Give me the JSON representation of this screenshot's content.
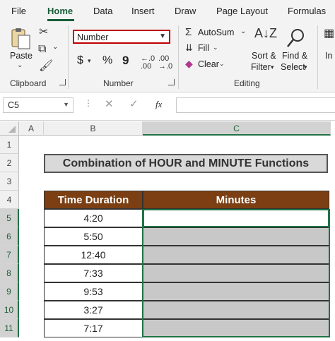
{
  "menu": {
    "tabs": [
      "File",
      "Home",
      "Data",
      "Insert",
      "Draw",
      "Page Layout",
      "Formulas"
    ],
    "active": "Home"
  },
  "ribbon": {
    "clipboard": {
      "paste_label": "Paste",
      "group_label": "Clipboard"
    },
    "number": {
      "format_value": "Number",
      "currency_symbol": "$",
      "percent_symbol": "%",
      "comma_symbol": "9",
      "group_label": "Number"
    },
    "editing": {
      "autosum_label": "AutoSum",
      "fill_label": "Fill",
      "clear_label": "Clear",
      "sort_label_1": "Sort &",
      "sort_label_2": "Filter",
      "find_label_1": "Find &",
      "find_label_2": "Select",
      "group_label": "Editing"
    },
    "insert_partial": "In"
  },
  "formula_bar": {
    "name_box": "C5",
    "fx_symbol": "fx",
    "formula": ""
  },
  "grid": {
    "columns": [
      "A",
      "B",
      "C"
    ],
    "selected_column": "C",
    "rows": [
      "1",
      "2",
      "3",
      "4",
      "5",
      "6",
      "7",
      "8",
      "9",
      "10",
      "11"
    ],
    "selected_rows": [
      "5",
      "6",
      "7",
      "8",
      "9",
      "10",
      "11"
    ]
  },
  "sheet": {
    "title": "Combination of HOUR and MINUTE Functions",
    "headers": [
      "Time Duration",
      "Minutes"
    ],
    "durations": [
      "4:20",
      "5:50",
      "12:40",
      "7:33",
      "9:53",
      "3:27",
      "7:17"
    ]
  },
  "colors": {
    "accent_green": "#217346",
    "header_brown": "#7b3f13",
    "highlight_red": "#c00000"
  }
}
